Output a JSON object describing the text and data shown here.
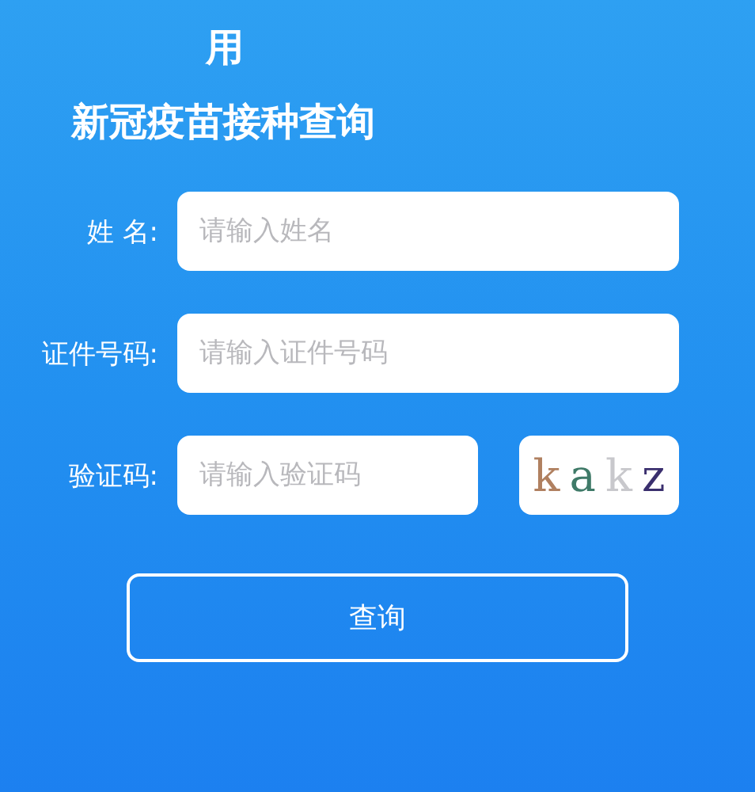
{
  "header": {
    "greeting": "用",
    "title": "新冠疫苗接种查询"
  },
  "fields": [
    {
      "label": "姓 名:",
      "placeholder": "请输入姓名"
    },
    {
      "label": "证件号码:",
      "placeholder": "请输入证件号码"
    },
    {
      "label": "验证码:",
      "placeholder": "请输入验证码"
    }
  ],
  "captcha": {
    "letters": [
      {
        "text": "k",
        "color": "#b08060"
      },
      {
        "text": "a",
        "color": "#3f7a68"
      },
      {
        "text": "k",
        "color": "#c8c8cc"
      },
      {
        "text": "z",
        "color": "#3a2f6e"
      }
    ]
  },
  "submit_button": "查询"
}
